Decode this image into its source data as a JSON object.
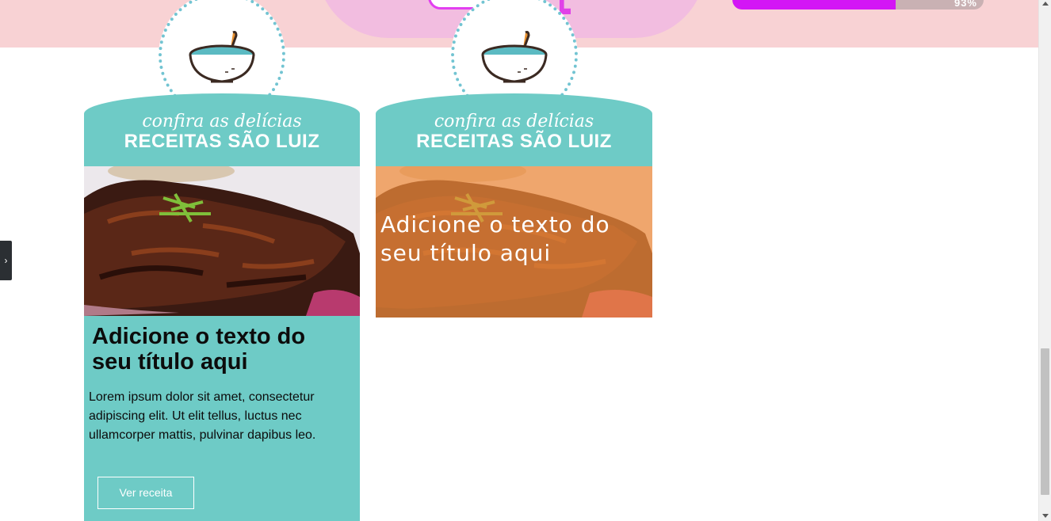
{
  "top_banner": {
    "progress_label": "93%",
    "progress_value": 0.65,
    "progress_color": "#d316f5",
    "background_color": "#f8d2d4"
  },
  "side_toggle": {
    "icon": "chevron-right-icon",
    "glyph": "›"
  },
  "cards": [
    {
      "badge_icon": "soup-bowl-icon",
      "header_script": "confira as delícias",
      "header_brand": "RECEITAS SÃO LUIZ",
      "image": "glazed-ribs-photo",
      "title": "Adicione o texto do seu título aqui",
      "text": "Lorem ipsum dolor sit amet, consectetur adipiscing elit. Ut elit tellus, luctus nec ullamcorper mattis, pulvinar dapibus leo.",
      "button_label": "Ver receita"
    },
    {
      "badge_icon": "soup-bowl-icon",
      "header_script": "confira as delícias",
      "header_brand": "RECEITAS SÃO LUIZ",
      "image": "glazed-ribs-photo-orange-overlay",
      "overlay_title": "Adicione o texto do seu título aqui"
    }
  ],
  "colors": {
    "teal": "#6ecbc6",
    "badge_dots": "#72c4d2",
    "overlay_orange": "#f08c3c"
  }
}
